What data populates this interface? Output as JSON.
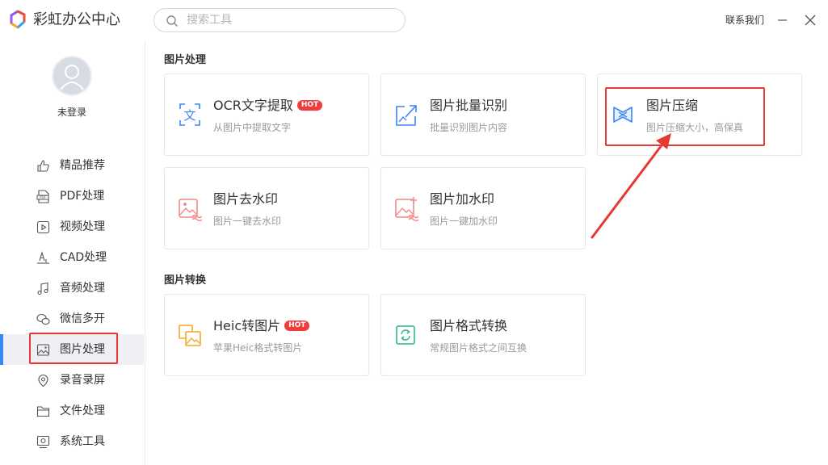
{
  "app": {
    "title": "彩虹办公中心"
  },
  "search": {
    "placeholder": "搜索工具"
  },
  "header": {
    "contact": "联系我们"
  },
  "user": {
    "status": "未登录"
  },
  "sidebar": {
    "items": [
      {
        "label": "精品推荐",
        "icon": "thumbs-up-icon"
      },
      {
        "label": "PDF处理",
        "icon": "pdf-icon"
      },
      {
        "label": "视频处理",
        "icon": "play-icon"
      },
      {
        "label": "CAD处理",
        "icon": "cad-icon"
      },
      {
        "label": "音频处理",
        "icon": "music-icon"
      },
      {
        "label": "微信多开",
        "icon": "wechat-icon"
      },
      {
        "label": "图片处理",
        "icon": "image-icon",
        "active": true
      },
      {
        "label": "录音录屏",
        "icon": "record-icon"
      },
      {
        "label": "文件处理",
        "icon": "folder-icon"
      },
      {
        "label": "系统工具",
        "icon": "system-icon"
      }
    ]
  },
  "sections": [
    {
      "title": "图片处理",
      "cards": [
        {
          "title": "OCR文字提取",
          "desc": "从图片中提取文字",
          "hot": "HOT",
          "icon": "ocr-text-icon"
        },
        {
          "title": "图片批量识别",
          "desc": "批量识别图片内容",
          "icon": "image-export-icon"
        },
        {
          "title": "图片压缩",
          "desc": "图片压缩大小，高保真",
          "icon": "compress-icon"
        },
        {
          "title": "图片去水印",
          "desc": "图片一键去水印",
          "icon": "remove-watermark-icon"
        },
        {
          "title": "图片加水印",
          "desc": "图片一键加水印",
          "icon": "add-watermark-icon"
        }
      ]
    },
    {
      "title": "图片转换",
      "cards": [
        {
          "title": "Heic转图片",
          "desc": "苹果Heic格式转图片",
          "hot": "HOT",
          "icon": "heic-convert-icon"
        },
        {
          "title": "图片格式转换",
          "desc": "常规图片格式之间互换",
          "icon": "format-convert-icon"
        }
      ]
    }
  ],
  "colors": {
    "accent": "#3b86f7",
    "hot": "#f23b3b",
    "annotation": "#e53935"
  }
}
